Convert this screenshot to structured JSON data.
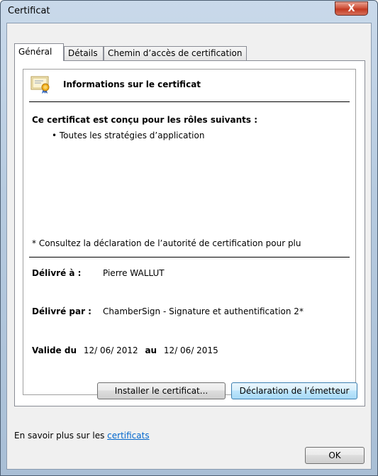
{
  "window": {
    "title": "Certificat",
    "close_glyph": "X"
  },
  "tabs": [
    {
      "label": "Général",
      "active": true
    },
    {
      "label": "Détails",
      "active": false
    },
    {
      "label": "Chemin d’accès de certification",
      "active": false
    }
  ],
  "cert_info": {
    "icon": "certificate-icon",
    "heading": "Informations sur le certificat",
    "purposes_title": "Ce certificat est conçu pour les rôles suivants :",
    "purposes": [
      "• Toutes les stratégies d’application"
    ],
    "cps_note": "* Consultez la déclaration de l’autorité de certification pour plu",
    "issued_to_label": "Délivré à :",
    "issued_to_value": "Pierre WALLUT",
    "issued_by_label": "Délivré par :",
    "issued_by_value": "ChamberSign - Signature et authentification 2*",
    "valid_from_label": "Valide du",
    "valid_from_value": "12/ 06/ 2012",
    "valid_to_label": "au",
    "valid_to_value": "12/ 06/ 2015"
  },
  "buttons": {
    "install": "Installer le certificat...",
    "issuer_statement": "Déclaration de l’émetteur",
    "ok": "OK"
  },
  "learn_more": {
    "prefix": "En savoir plus sur les ",
    "link": "certificats"
  }
}
